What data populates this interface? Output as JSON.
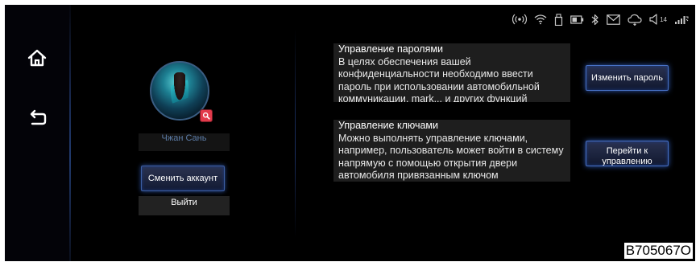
{
  "colors": {
    "background": "#000000",
    "accent_blue": "#4770c4",
    "username_text": "#5d7da8",
    "badge_red": "#e23a4b"
  },
  "nav": {
    "home_icon": "home-icon",
    "back_icon": "back-icon"
  },
  "status_bar": {
    "icons": [
      "hotspot-icon",
      "wifi-icon",
      "usb-icon",
      "battery-icon",
      "bluetooth-icon",
      "mail-icon",
      "cloud-icon",
      "volume-icon",
      "signal-icon"
    ],
    "volume_level": "14"
  },
  "profile": {
    "user_name": "Чжан Сань",
    "switch_account_label": "Сменить аккаунт",
    "logout_label": "Выйти"
  },
  "password_section": {
    "title": "Управление паролями",
    "description": "В целях обеспечения вашей конфиденциальности необходимо ввести пароль при использовании автомобильной коммуникации, mark... и других функций",
    "button_label": "Изменить пароль"
  },
  "keys_section": {
    "title": "Управление ключами",
    "description": "Можно выполнять управление ключами, например, пользователь может войти в систему напрямую с помощью открытия двери автомобиля привязанным ключом",
    "button_label": "Перейти к управлению"
  },
  "watermark": "B705067O"
}
